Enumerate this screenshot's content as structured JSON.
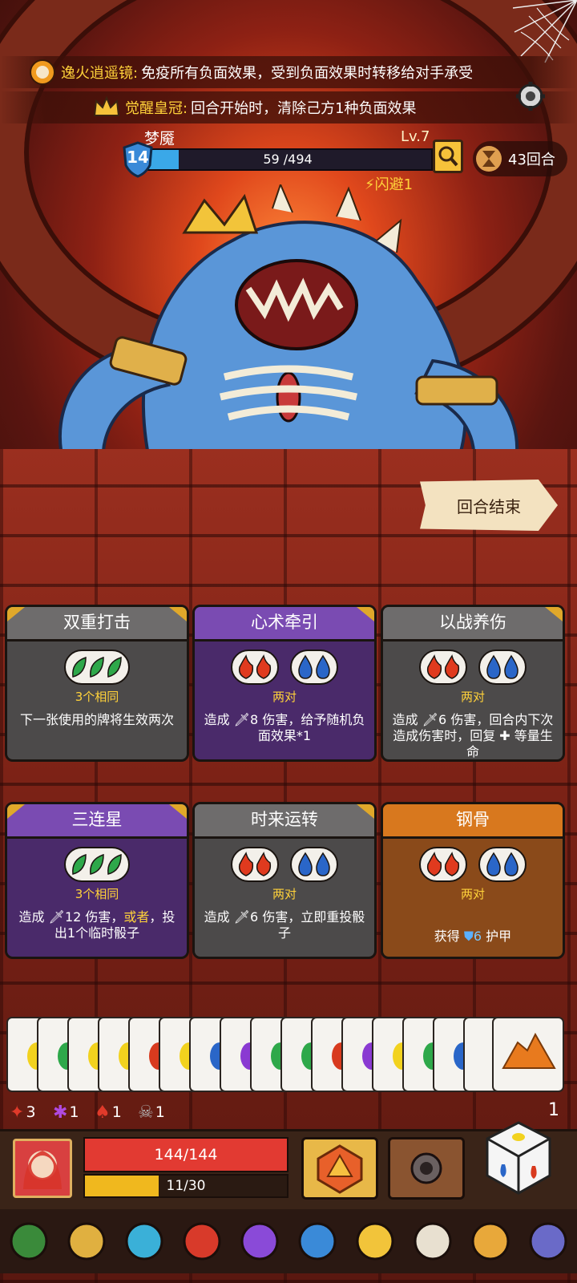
{
  "effects": [
    {
      "name": "逸火逍遥镜:",
      "desc": "免疫所有负面效果，受到负面效果时转移给对手承受",
      "icon": "flame-mirror-icon"
    },
    {
      "name": "觉醒皇冠:",
      "desc": "回合开始时，清除己方1种负面效果",
      "icon": "crown-icon"
    }
  ],
  "enemy": {
    "name": "梦魇",
    "level": "Lv.7",
    "shield": "14",
    "hp_text": "59 /494",
    "hp_fraction": 0.119,
    "dodge": "闪避1"
  },
  "rounds": "43回合",
  "end_turn": "回合结束",
  "cards": [
    {
      "title": "双重打击",
      "gems": [
        "green",
        "green",
        "green"
      ],
      "req": "3个相同",
      "desc": "下一张使用的牌将生效两次",
      "style": "gray"
    },
    {
      "title": "心术牵引",
      "gems": [
        "red",
        "red",
        "|",
        "blue",
        "blue"
      ],
      "req": "两对",
      "desc": "造成 🗡8 伤害，给予随机负面效果*1",
      "style": "purple"
    },
    {
      "title": "以战养伤",
      "gems": [
        "red",
        "red",
        "|",
        "blue",
        "blue"
      ],
      "req": "两对",
      "desc": "造成 🗡6 伤害，回合内下次造成伤害时，回复 ✚ 等量生命",
      "style": "gray"
    },
    {
      "title": "三连星",
      "gems": [
        "green",
        "green",
        "green"
      ],
      "req": "3个相同",
      "desc_parts": [
        "造成 🗡12 伤害，",
        "或者",
        "，投出1个临时骰子"
      ],
      "style": "purple"
    },
    {
      "title": "时来运转",
      "gems": [
        "red",
        "red",
        "|",
        "blue",
        "blue"
      ],
      "req": "两对",
      "desc": "造成 🗡6 伤害，立即重投骰子",
      "style": "gray"
    },
    {
      "title": "钢骨",
      "gems": [
        "red",
        "red",
        "|",
        "blue",
        "blue"
      ],
      "req": "两对",
      "desc_parts": [
        "获得 ",
        "6",
        " 护甲"
      ],
      "style": "orange"
    }
  ],
  "hand_colors": [
    "#f2d21e",
    "#2ea84a",
    "#f2d21e",
    "#f2d21e",
    "#d83a1e",
    "#f2d21e",
    "#2a66c8",
    "#8a3ad2",
    "#2ea84a",
    "#2ea84a",
    "#d83a1e",
    "#8a3ad2",
    "#f2d21e",
    "#2ea84a",
    "#2a66c8",
    "#e86a1e"
  ],
  "status": [
    {
      "icon": "bleed-icon",
      "value": "3",
      "color": "#e03a2a"
    },
    {
      "icon": "poison-splat-icon",
      "value": "1",
      "color": "#b04ae0"
    },
    {
      "icon": "demon-icon",
      "value": "1",
      "color": "#e03a2a"
    },
    {
      "icon": "skull-icon",
      "value": "1",
      "color": "#b0b0b0"
    }
  ],
  "deck_count": "1",
  "player": {
    "hp_text": "144/144",
    "exp_text": "11/30",
    "exp_fraction": 0.367
  },
  "relics": [
    "spellbook-icon",
    "helmet-icon",
    "shield-gem-icon",
    "potion-icon",
    "hood-icon",
    "spiked-orb-icon",
    "crown-relic-icon",
    "scroll-icon",
    "mushroom-icon",
    "wing-helm-icon"
  ]
}
